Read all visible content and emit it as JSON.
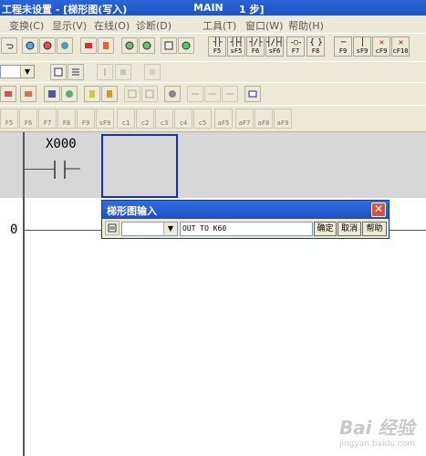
{
  "title_bar": {
    "app_title": "工程未设置 - [梯形图(写入)",
    "program": "MAIN",
    "steps": "1 步]"
  },
  "menu": {
    "items": [
      "变换(C)",
      "显示(V)",
      "在线(O)",
      "诊断(D)",
      "工具(T)",
      "窗口(W)",
      "帮助(H)"
    ]
  },
  "fkeys": [
    {
      "sym": "┤├",
      "label": "F5"
    },
    {
      "sym": "┤├┤",
      "label": "sF5"
    },
    {
      "sym": "┤/├",
      "label": "F6"
    },
    {
      "sym": "┤/├┤",
      "label": "sF6"
    },
    {
      "sym": "-○-",
      "label": "F7"
    },
    {
      "sym": "{ }",
      "label": "F8"
    },
    {
      "sym": "─",
      "label": "F9"
    },
    {
      "sym": "│",
      "label": "sF9"
    },
    {
      "sym": "✕",
      "label": "cF9"
    },
    {
      "sym": "✕",
      "label": "cF10"
    }
  ],
  "bottom_fkeys": [
    "F5",
    "F6",
    "F7",
    "F8",
    "F9",
    "sF9",
    "c1",
    "c2",
    "c3",
    "c4",
    "c5",
    "aF5",
    "aF7",
    "aF8",
    "aF9"
  ],
  "ladder": {
    "contact_label": "X000",
    "step_number": "0"
  },
  "dialog": {
    "title": "梯形图输入",
    "input_value": "OUT TO K60",
    "ok_label": "确定",
    "cancel_label": "取消",
    "help_label": "帮助",
    "close_symbol": "✕"
  },
  "watermark": {
    "brand": "Bai 经验",
    "url": "jingyan.baidu.com"
  }
}
